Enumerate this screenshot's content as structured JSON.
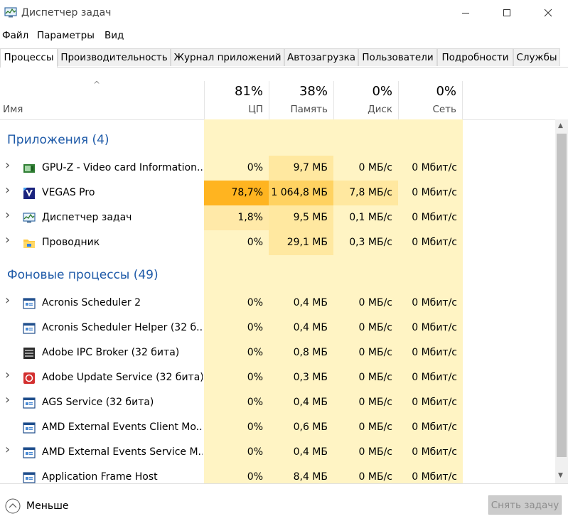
{
  "window": {
    "title": "Диспетчер задач"
  },
  "menu": [
    "Файл",
    "Параметры",
    "Вид"
  ],
  "tabs": [
    "Процессы",
    "Производительность",
    "Журнал приложений",
    "Автозагрузка",
    "Пользователи",
    "Подробности",
    "Службы"
  ],
  "columns": {
    "name": "Имя",
    "cpu": {
      "pct": "81%",
      "label": "ЦП"
    },
    "mem": {
      "pct": "38%",
      "label": "Память"
    },
    "disk": {
      "pct": "0%",
      "label": "Диск"
    },
    "net": {
      "pct": "0%",
      "label": "Сеть"
    }
  },
  "groups": {
    "apps": "Приложения (4)",
    "background": "Фоновые процессы (49)"
  },
  "rows": [
    {
      "name": "GPU-Z - Video card Information...",
      "cpu": "0%",
      "mem": "9,7 МБ",
      "disk": "0 МБ/с",
      "net": "0 Мбит/с",
      "icon": "gpu-z-icon"
    },
    {
      "name": "VEGAS Pro",
      "cpu": "78,7%",
      "mem": "1 064,8 МБ",
      "disk": "7,8 МБ/с",
      "net": "0 Мбит/с",
      "icon": "vegas-pro-icon"
    },
    {
      "name": "Диспетчер задач",
      "cpu": "1,8%",
      "mem": "9,5 МБ",
      "disk": "0,1 МБ/с",
      "net": "0 Мбит/с",
      "icon": "task-manager-icon"
    },
    {
      "name": "Проводник",
      "cpu": "0%",
      "mem": "29,1 МБ",
      "disk": "0,3 МБ/с",
      "net": "0 Мбит/с",
      "icon": "folder-icon"
    },
    {
      "name": "Acronis Scheduler 2",
      "cpu": "0%",
      "mem": "0,4 МБ",
      "disk": "0 МБ/с",
      "net": "0 Мбит/с",
      "icon": "window-app-icon"
    },
    {
      "name": "Acronis Scheduler Helper (32 б...",
      "cpu": "0%",
      "mem": "0,4 МБ",
      "disk": "0 МБ/с",
      "net": "0 Мбит/с",
      "icon": "window-app-icon"
    },
    {
      "name": "Adobe IPC Broker (32 бита)",
      "cpu": "0%",
      "mem": "0,8 МБ",
      "disk": "0 МБ/с",
      "net": "0 Мбит/с",
      "icon": "adobe-ipc-icon"
    },
    {
      "name": "Adobe Update Service (32 бита)",
      "cpu": "0%",
      "mem": "0,3 МБ",
      "disk": "0 МБ/с",
      "net": "0 Мбит/с",
      "icon": "adobe-update-icon"
    },
    {
      "name": "AGS Service (32 бита)",
      "cpu": "0%",
      "mem": "0,4 МБ",
      "disk": "0 МБ/с",
      "net": "0 Мбит/с",
      "icon": "window-app-icon"
    },
    {
      "name": "AMD External Events Client Mo...",
      "cpu": "0%",
      "mem": "0,6 МБ",
      "disk": "0 МБ/с",
      "net": "0 Мбит/с",
      "icon": "window-app-icon"
    },
    {
      "name": "AMD External Events Service M...",
      "cpu": "0%",
      "mem": "0,4 МБ",
      "disk": "0 МБ/с",
      "net": "0 Мбит/с",
      "icon": "window-app-icon"
    },
    {
      "name": "Application Frame Host",
      "cpu": "0%",
      "mem": "8,4 МБ",
      "disk": "0 МБ/с",
      "net": "0 Мбит/с",
      "icon": "window-app-icon"
    }
  ],
  "footer": {
    "less": "Меньше",
    "end_task": "Снять задачу"
  },
  "colors": {
    "group": "#1e5aa8",
    "heat_light": "#fff4c4",
    "heat_mid": "#ffe8a0",
    "heat_high": "#ffb420",
    "heat_cpu_mid": "#ffe9a8"
  }
}
